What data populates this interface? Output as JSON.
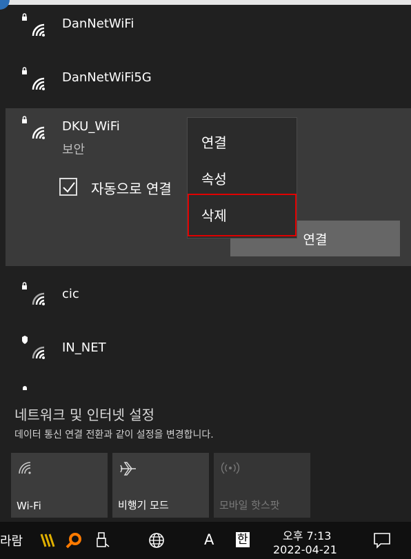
{
  "networks": [
    {
      "name": "DanNetWiFi"
    },
    {
      "name": "DanNetWiFi5G"
    },
    {
      "name": "DKU_WiFi",
      "status": "보안"
    },
    {
      "name": "cic"
    },
    {
      "name": "IN_NET"
    }
  ],
  "selected": {
    "auto_connect_label": "자동으로 연결",
    "connect_button": "연결"
  },
  "context_menu": {
    "items": [
      "연결",
      "속성",
      "삭제"
    ],
    "highlighted": "삭제"
  },
  "settings": {
    "title": "네트워크 및 인터넷 설정",
    "description": "데이터 통신 연결 전환과 같이 설정을 변경합니다."
  },
  "quick_actions": [
    {
      "label": "Wi-Fi",
      "icon": "wifi-icon"
    },
    {
      "label": "비행기 모드",
      "icon": "airplane-icon"
    },
    {
      "label": "모바일 핫스팟",
      "icon": "hotspot-icon"
    }
  ],
  "taskbar": {
    "left_text": "라람",
    "ime_label": "A",
    "ime_hangul": "한",
    "time": "오후 7:13",
    "date": "2022-04-21"
  },
  "colors": {
    "highlight_box": "#e10000",
    "accent": "#2c6fb7"
  }
}
